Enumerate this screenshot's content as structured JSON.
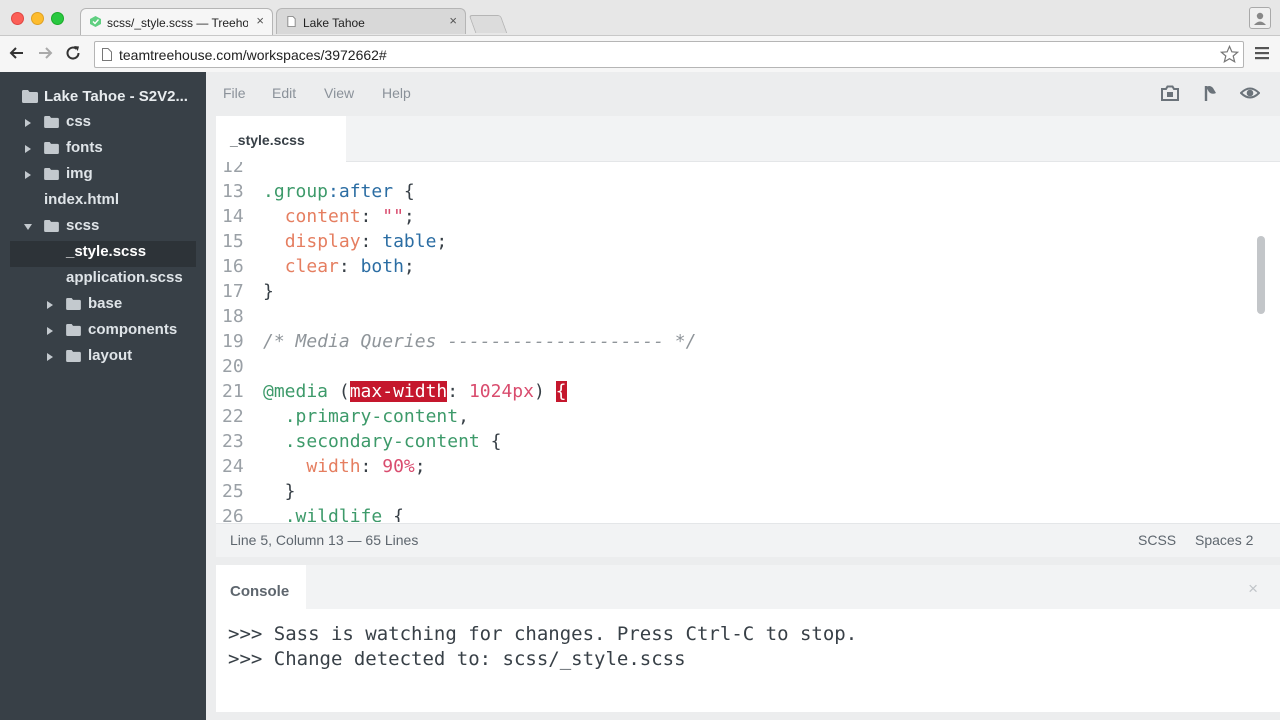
{
  "browser": {
    "tabs": [
      {
        "title": "scss/_style.scss — Treehouse",
        "active": true
      },
      {
        "title": "Lake Tahoe",
        "active": false
      }
    ],
    "url": "teamtreehouse.com/workspaces/3972662#"
  },
  "sidebar": {
    "project": "Lake Tahoe - S2V2...",
    "items": [
      {
        "label": "css",
        "type": "folder",
        "expanded": false
      },
      {
        "label": "fonts",
        "type": "folder",
        "expanded": false
      },
      {
        "label": "img",
        "type": "folder",
        "expanded": false
      },
      {
        "label": "index.html",
        "type": "file"
      },
      {
        "label": "scss",
        "type": "folder",
        "expanded": true
      },
      {
        "label": "_style.scss",
        "type": "file",
        "selected": true
      },
      {
        "label": "application.scss",
        "type": "file"
      },
      {
        "label": "base",
        "type": "folder",
        "expanded": false
      },
      {
        "label": "components",
        "type": "folder",
        "expanded": false
      },
      {
        "label": "layout",
        "type": "folder",
        "expanded": false
      }
    ]
  },
  "menu": {
    "file": "File",
    "edit": "Edit",
    "view": "View",
    "help": "Help",
    "icons": [
      "snapshot-icon",
      "share-icon",
      "preview-icon"
    ]
  },
  "editor": {
    "tab": "_style.scss",
    "lines": [
      {
        "n": "12",
        "code": ""
      },
      {
        "n": "13",
        "code": ".group:after {"
      },
      {
        "n": "14",
        "code": "  content: \"\";"
      },
      {
        "n": "15",
        "code": "  display: table;"
      },
      {
        "n": "16",
        "code": "  clear: both;"
      },
      {
        "n": "17",
        "code": "}"
      },
      {
        "n": "18",
        "code": ""
      },
      {
        "n": "19",
        "code": "/* Media Queries -------------------- */"
      },
      {
        "n": "20",
        "code": ""
      },
      {
        "n": "21",
        "code": "@media (max-width: 1024px) {"
      },
      {
        "n": "22",
        "code": "  .primary-content,"
      },
      {
        "n": "23",
        "code": "  .secondary-content {"
      },
      {
        "n": "24",
        "code": "    width: 90%;"
      },
      {
        "n": "25",
        "code": "  }"
      },
      {
        "n": "26",
        "code": "  .wildlife {"
      }
    ]
  },
  "status": {
    "position": "Line 5, Column 13 — 65 Lines",
    "mode": "SCSS",
    "indent": "Spaces 2"
  },
  "console": {
    "title": "Console",
    "close": "×",
    "lines": [
      ">>> Sass is watching for changes. Press Ctrl-C to stop.",
      ">>> Change detected to: scss/_style.scss"
    ]
  },
  "colors": {
    "sidebar_bg": "#384047",
    "highlight": "#c5172d",
    "selector": "#3d9a6a",
    "property": "#e57e60",
    "value": "#2b6da3",
    "number": "#d94c6e"
  }
}
